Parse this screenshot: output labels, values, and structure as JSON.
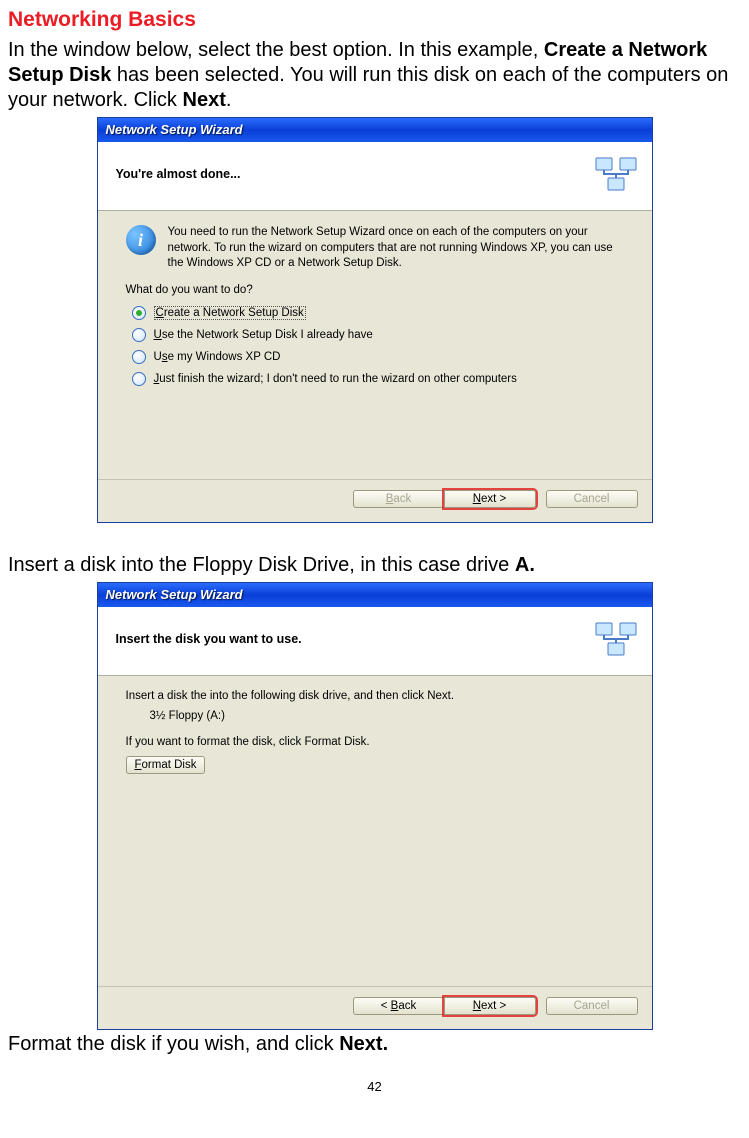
{
  "page_title": "Networking Basics",
  "intro": {
    "t1": "In the window below, select the best option.  In this example, ",
    "b1": "Create a Network Setup Disk",
    "t2": " has been selected.  You will run this disk on each of the computers on your network.  Click ",
    "b2": "Next",
    "t3": "."
  },
  "wiz1": {
    "title": "Network Setup Wizard",
    "banner": "You're almost done...",
    "info": "You need to run the Network Setup Wizard once on each of the computers on your network. To run the wizard on computers that are not running Windows XP, you can use the Windows XP CD or a Network Setup Disk.",
    "prompt": "What do you want to do?",
    "opt1_pre": "C",
    "opt1_rest": "reate a Network Setup Disk",
    "opt2_pre": "U",
    "opt2_rest": "se the Network Setup Disk I already have",
    "opt3_pre": "s",
    "opt3_before": "U",
    "opt3_rest": "e my Windows XP CD",
    "opt4_pre": "J",
    "opt4_rest": "ust finish the wizard; I don't need to run the wizard on other computers",
    "back": "< Back",
    "next": "Next >",
    "cancel": "Cancel"
  },
  "mid": {
    "t1": "Insert a disk into the Floppy Disk Drive, in this case drive ",
    "b1": "A."
  },
  "wiz2": {
    "title": "Network Setup Wizard",
    "banner": "Insert the disk you want to use.",
    "line1": "Insert a disk the into the following disk drive, and then click Next.",
    "drive": "3½ Floppy (A:)",
    "line2": "If you want to format the disk, click Format Disk.",
    "format_pre": "F",
    "format_rest": "ormat Disk",
    "back": "< Back",
    "next": "Next >",
    "cancel": "Cancel"
  },
  "outro": {
    "t1": "Format the disk if you wish, and click ",
    "b1": "Next."
  },
  "page_number": "42"
}
